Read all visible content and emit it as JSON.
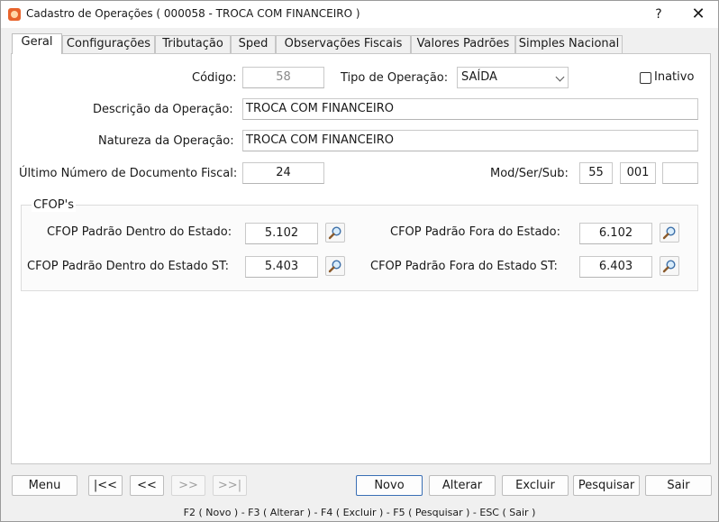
{
  "window": {
    "title": "Cadastro de Operações ( 000058 - TROCA COM FINANCEIRO )",
    "help_label": "?",
    "close_label": "✕"
  },
  "tabs": [
    {
      "label": "Geral",
      "active": true
    },
    {
      "label": "Configurações"
    },
    {
      "label": "Tributação"
    },
    {
      "label": "Sped"
    },
    {
      "label": "Observações Fiscais"
    },
    {
      "label": "Valores Padrões"
    },
    {
      "label": "Simples Nacional"
    }
  ],
  "form": {
    "codigo_label": "Código:",
    "codigo_value": "58",
    "tipo_label": "Tipo de Operação:",
    "tipo_value": "SAÍDA",
    "inativo_label": "Inativo",
    "inativo_checked": false,
    "descricao_label": "Descrição da Operação:",
    "descricao_value": "TROCA COM FINANCEIRO",
    "natureza_label": "Natureza da Operação:",
    "natureza_value": "TROCA COM FINANCEIRO",
    "ultimo_label": "Último Número de Documento Fiscal:",
    "ultimo_value": "24",
    "modsersub_label": "Mod/Ser/Sub:",
    "mod_value": "55",
    "ser_value": "001",
    "sub_value": ""
  },
  "cfop": {
    "group_title": "CFOP's",
    "dentro_label": "CFOP Padrão Dentro do Estado:",
    "dentro_value": "5.102",
    "fora_label": "CFOP Padrão Fora do Estado:",
    "fora_value": "6.102",
    "dentro_st_label": "CFOP Padrão Dentro do Estado ST:",
    "dentro_st_value": "5.403",
    "fora_st_label": "CFOP Padrão Fora do Estado ST:",
    "fora_st_value": "6.403"
  },
  "buttons": {
    "menu": "Menu",
    "first": "|<<",
    "prev": "<<",
    "next": ">>",
    "last": ">>|",
    "novo": "Novo",
    "alterar": "Alterar",
    "excluir": "Excluir",
    "pesquisar": "Pesquisar",
    "sair": "Sair"
  },
  "statusbar": {
    "text": "F2 ( Novo )  -  F3 ( Alterar )  -  F4 ( Excluir )  -  F5 ( Pesquisar )  -  ESC ( Sair )"
  },
  "colors": {
    "primary_border": "#3a6fb5",
    "app_icon": "#e8642c"
  },
  "icons": {
    "search": "magnifier-icon",
    "app": "app-icon"
  }
}
